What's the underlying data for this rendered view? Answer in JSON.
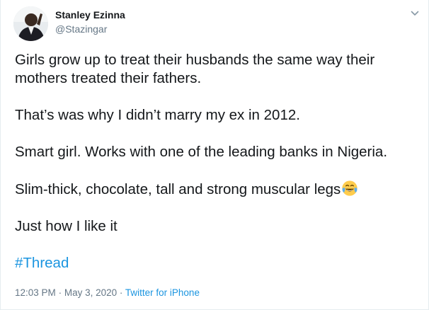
{
  "tweet": {
    "author_name": "Stanley Ezinna",
    "author_handle": "@Stazingar",
    "paragraphs": [
      "Girls grow up to treat their husbands the same way their mothers treated their fathers.",
      "That’s was why I didn’t marry my ex in 2012.",
      "Smart girl. Works with one of the leading banks in Nigeria.",
      "Slim-thick, chocolate, tall and strong muscular legs",
      "Just how I like it"
    ],
    "emoji": "face-with-tears-of-joy",
    "hashtag": "#Thread",
    "time": "12:03 PM",
    "date": "May 3, 2020",
    "separator": "·",
    "source": "Twitter for iPhone"
  },
  "icons": {
    "more": "chevron-down-icon",
    "avatar": "profile-photo"
  },
  "colors": {
    "link": "#1b95e0",
    "text": "#14171a",
    "muted": "#657786",
    "border": "#e6ecf0"
  }
}
